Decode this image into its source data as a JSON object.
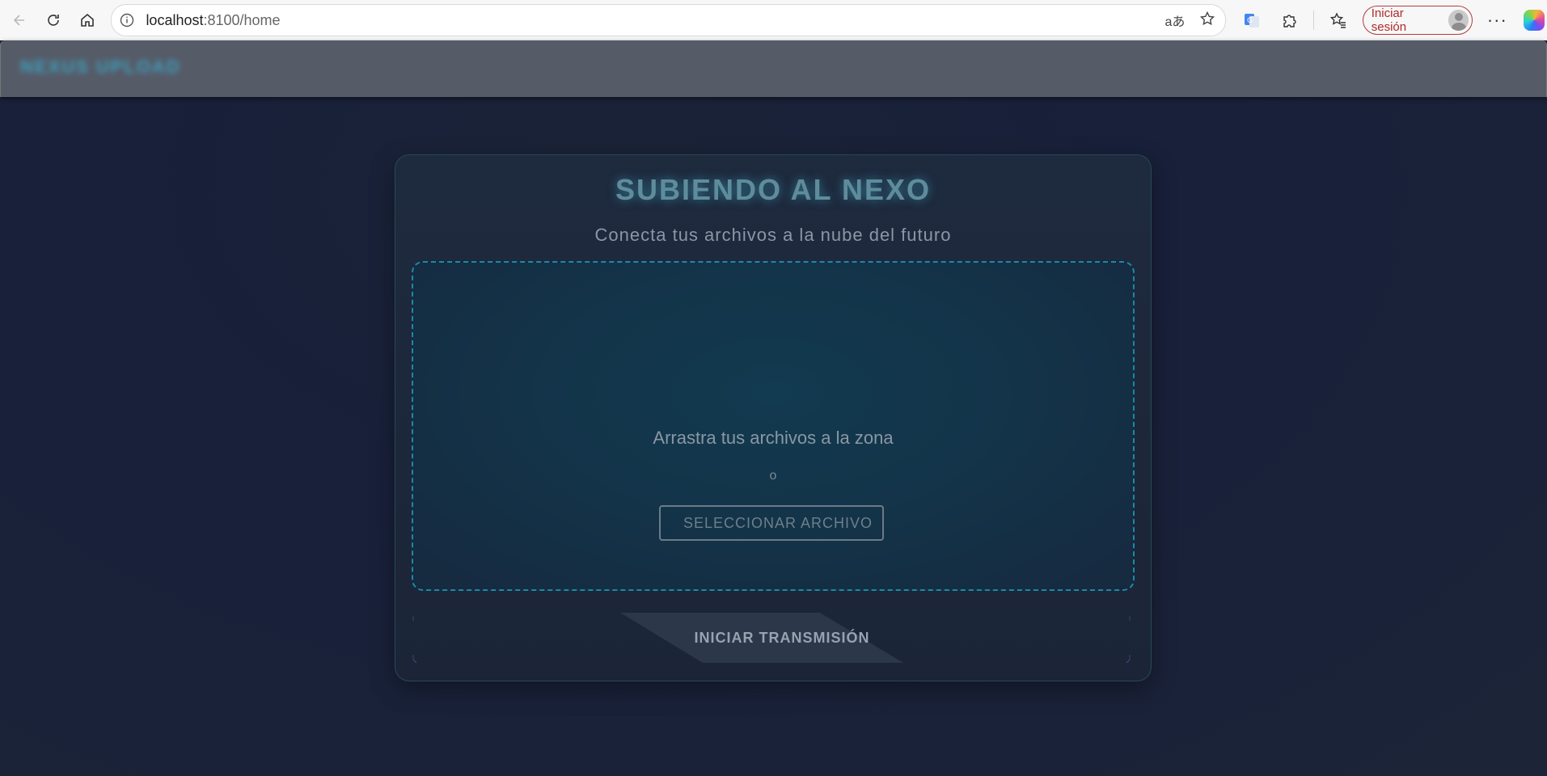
{
  "browser": {
    "url_host": "localhost",
    "url_rest": ":8100/home",
    "signin_label": "Iniciar sesión",
    "translate_glyph": "aあ",
    "icons": {
      "back": "back-arrow-icon",
      "reload": "reload-icon",
      "home": "home-icon",
      "info": "info-icon",
      "translate": "translate-icon",
      "favorite": "star-icon",
      "google_translate_ext": "google-translate-icon",
      "extensions": "puzzle-icon",
      "favorites": "favorites-icon",
      "more": "more-icon",
      "copilot": "copilot-icon"
    }
  },
  "app": {
    "header_title": "NEXUS UPLOAD",
    "colors": {
      "accent": "#1b8aa6",
      "header_bg": "#565b68",
      "page_bg": "#1a2234"
    }
  },
  "upload_card": {
    "title": "SUBIENDO AL NEXO",
    "subtitle": "Conecta tus archivos a la nube del futuro",
    "dropzone": {
      "prompt": "Arrastra tus archivos a la zona",
      "or_text": "o",
      "select_button": "SELECCIONAR ARCHIVO"
    },
    "transmit_button": "INICIAR TRANSMISIÓN"
  }
}
